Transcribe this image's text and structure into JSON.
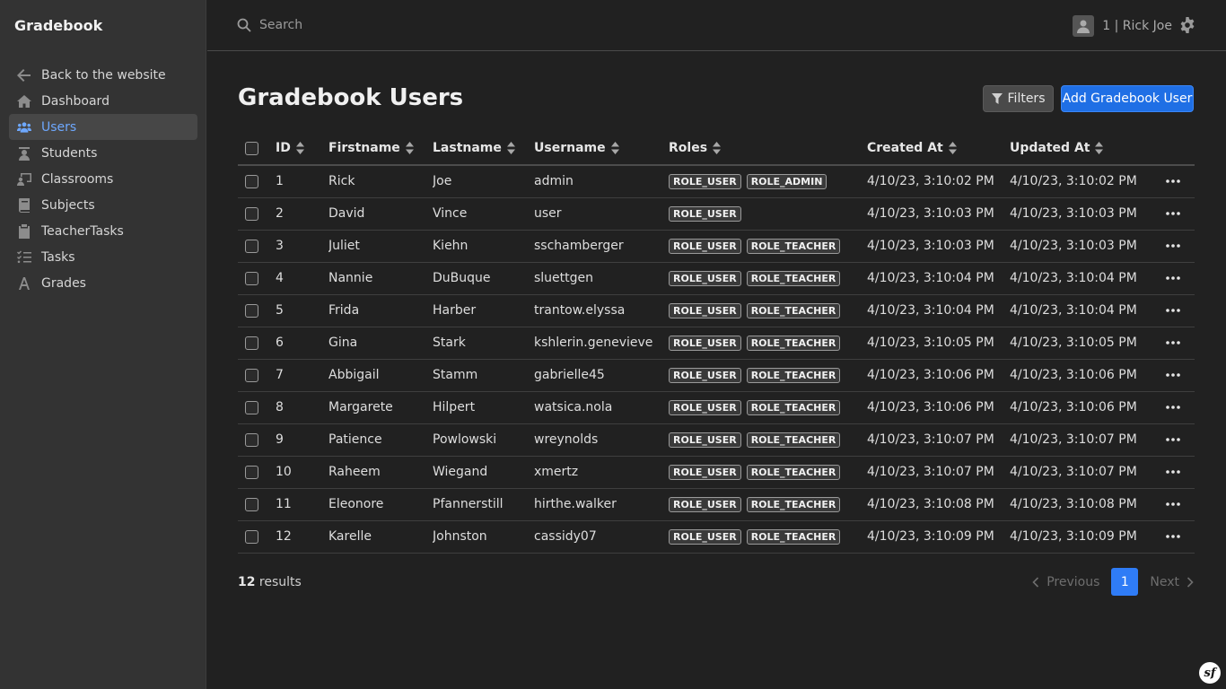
{
  "app": {
    "brand": "Gradebook"
  },
  "sidebar": {
    "items": [
      {
        "label": "Back to the website",
        "icon": "arrow-left-icon",
        "active": false
      },
      {
        "label": "Dashboard",
        "icon": "home-icon",
        "active": false
      },
      {
        "label": "Users",
        "icon": "users-icon",
        "active": true
      },
      {
        "label": "Students",
        "icon": "student-icon",
        "active": false
      },
      {
        "label": "Classrooms",
        "icon": "classroom-icon",
        "active": false
      },
      {
        "label": "Subjects",
        "icon": "book-icon",
        "active": false
      },
      {
        "label": "TeacherTasks",
        "icon": "clipboard-icon",
        "active": false
      },
      {
        "label": "Tasks",
        "icon": "list-check-icon",
        "active": false
      },
      {
        "label": "Grades",
        "icon": "font-icon",
        "active": false
      }
    ]
  },
  "topbar": {
    "search_placeholder": "Search",
    "search_value": "",
    "user_label": "1 | Rick Joe"
  },
  "page": {
    "title": "Gradebook Users",
    "filters_label": "Filters",
    "add_label": "Add Gradebook User"
  },
  "table": {
    "columns": [
      "ID",
      "Firstname",
      "Lastname",
      "Username",
      "Roles",
      "Created At",
      "Updated At"
    ],
    "rows": [
      {
        "id": "1",
        "firstname": "Rick",
        "lastname": "Joe",
        "username": "admin",
        "roles": [
          "ROLE_USER",
          "ROLE_ADMIN"
        ],
        "created": "4/10/23, 3:10:02 PM",
        "updated": "4/10/23, 3:10:02 PM"
      },
      {
        "id": "2",
        "firstname": "David",
        "lastname": "Vince",
        "username": "user",
        "roles": [
          "ROLE_USER"
        ],
        "created": "4/10/23, 3:10:03 PM",
        "updated": "4/10/23, 3:10:03 PM"
      },
      {
        "id": "3",
        "firstname": "Juliet",
        "lastname": "Kiehn",
        "username": "sschamberger",
        "roles": [
          "ROLE_USER",
          "ROLE_TEACHER"
        ],
        "created": "4/10/23, 3:10:03 PM",
        "updated": "4/10/23, 3:10:03 PM"
      },
      {
        "id": "4",
        "firstname": "Nannie",
        "lastname": "DuBuque",
        "username": "sluettgen",
        "roles": [
          "ROLE_USER",
          "ROLE_TEACHER"
        ],
        "created": "4/10/23, 3:10:04 PM",
        "updated": "4/10/23, 3:10:04 PM"
      },
      {
        "id": "5",
        "firstname": "Frida",
        "lastname": "Harber",
        "username": "trantow.elyssa",
        "roles": [
          "ROLE_USER",
          "ROLE_TEACHER"
        ],
        "created": "4/10/23, 3:10:04 PM",
        "updated": "4/10/23, 3:10:04 PM"
      },
      {
        "id": "6",
        "firstname": "Gina",
        "lastname": "Stark",
        "username": "kshlerin.genevieve",
        "roles": [
          "ROLE_USER",
          "ROLE_TEACHER"
        ],
        "created": "4/10/23, 3:10:05 PM",
        "updated": "4/10/23, 3:10:05 PM"
      },
      {
        "id": "7",
        "firstname": "Abbigail",
        "lastname": "Stamm",
        "username": "gabrielle45",
        "roles": [
          "ROLE_USER",
          "ROLE_TEACHER"
        ],
        "created": "4/10/23, 3:10:06 PM",
        "updated": "4/10/23, 3:10:06 PM"
      },
      {
        "id": "8",
        "firstname": "Margarete",
        "lastname": "Hilpert",
        "username": "watsica.nola",
        "roles": [
          "ROLE_USER",
          "ROLE_TEACHER"
        ],
        "created": "4/10/23, 3:10:06 PM",
        "updated": "4/10/23, 3:10:06 PM"
      },
      {
        "id": "9",
        "firstname": "Patience",
        "lastname": "Powlowski",
        "username": "wreynolds",
        "roles": [
          "ROLE_USER",
          "ROLE_TEACHER"
        ],
        "created": "4/10/23, 3:10:07 PM",
        "updated": "4/10/23, 3:10:07 PM"
      },
      {
        "id": "10",
        "firstname": "Raheem",
        "lastname": "Wiegand",
        "username": "xmertz",
        "roles": [
          "ROLE_USER",
          "ROLE_TEACHER"
        ],
        "created": "4/10/23, 3:10:07 PM",
        "updated": "4/10/23, 3:10:07 PM"
      },
      {
        "id": "11",
        "firstname": "Eleonore",
        "lastname": "Pfannerstill",
        "username": "hirthe.walker",
        "roles": [
          "ROLE_USER",
          "ROLE_TEACHER"
        ],
        "created": "4/10/23, 3:10:08 PM",
        "updated": "4/10/23, 3:10:08 PM"
      },
      {
        "id": "12",
        "firstname": "Karelle",
        "lastname": "Johnston",
        "username": "cassidy07",
        "roles": [
          "ROLE_USER",
          "ROLE_TEACHER"
        ],
        "created": "4/10/23, 3:10:09 PM",
        "updated": "4/10/23, 3:10:09 PM"
      }
    ]
  },
  "footer": {
    "results_count": "12",
    "results_label": " results",
    "prev_label": "Previous",
    "next_label": "Next",
    "current_page": "1"
  },
  "colors": {
    "accent": "#1f6fe5",
    "active_nav": "#6ea8fe",
    "background": "#212121",
    "sidebar": "#333333"
  }
}
